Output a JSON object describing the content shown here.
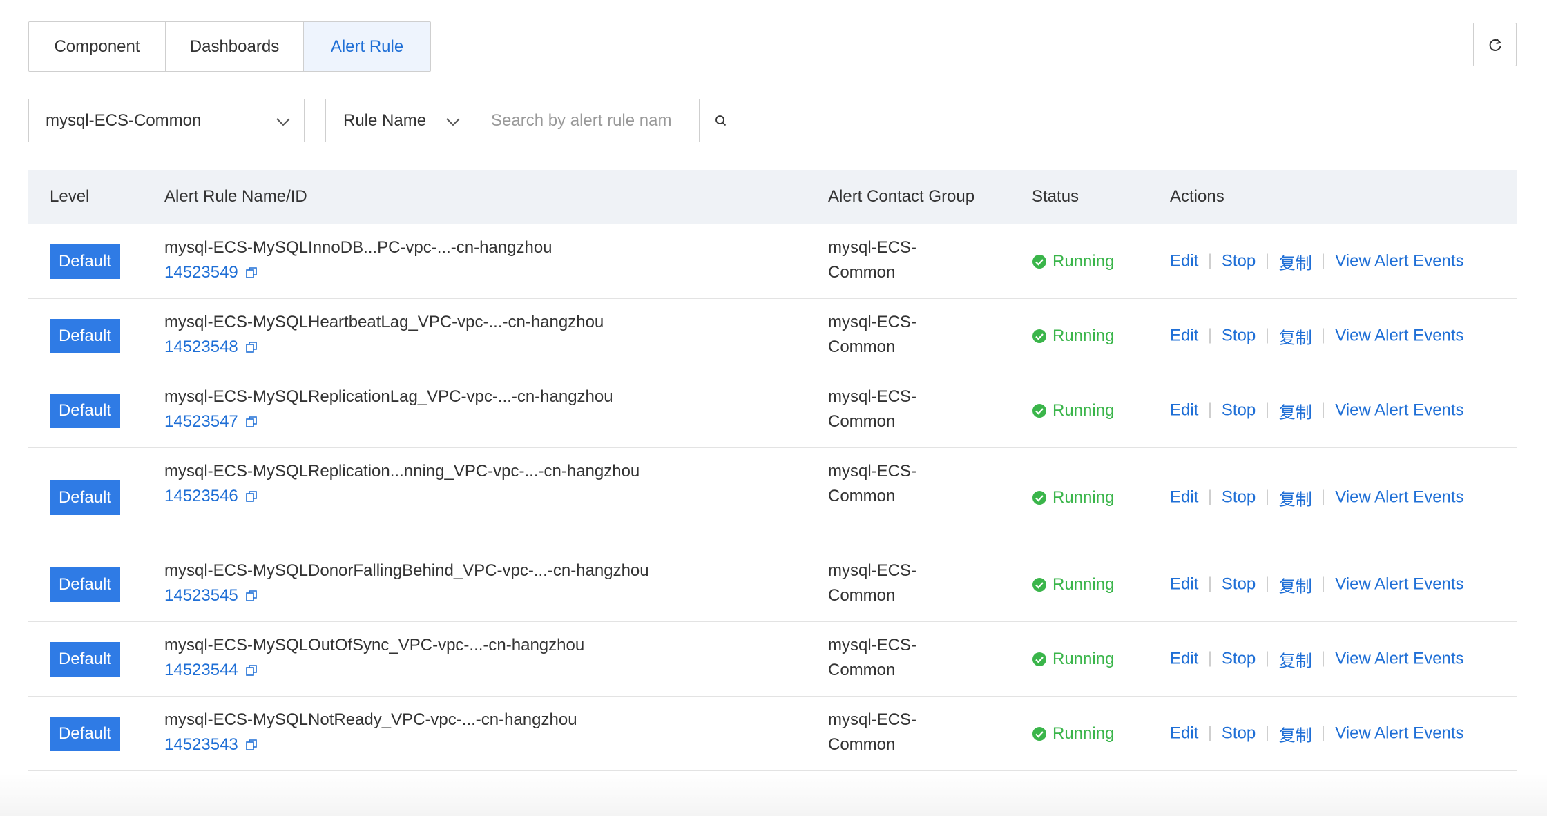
{
  "tabs": [
    {
      "label": "Component",
      "active": false
    },
    {
      "label": "Dashboards",
      "active": false
    },
    {
      "label": "Alert Rule",
      "active": true
    }
  ],
  "filters": {
    "app_select_value": "mysql-ECS-Common",
    "field_select_value": "Rule Name",
    "search_placeholder": "Search by alert rule nam"
  },
  "table": {
    "headers": {
      "level": "Level",
      "name": "Alert Rule Name/ID",
      "group": "Alert Contact Group",
      "status": "Status",
      "actions": "Actions"
    },
    "rows": [
      {
        "level": "Default",
        "name": "mysql-ECS-MySQLInnoDB...PC-vpc-...-cn-hangzhou",
        "id": "14523549",
        "group": "mysql-ECS-Common",
        "status": "Running"
      },
      {
        "level": "Default",
        "name": "mysql-ECS-MySQLHeartbeatLag_VPC-vpc-...-cn-hangzhou",
        "id": "14523548",
        "group": "mysql-ECS-Common",
        "status": "Running"
      },
      {
        "level": "Default",
        "name": "mysql-ECS-MySQLReplicationLag_VPC-vpc-...-cn-hangzhou",
        "id": "14523547",
        "group": "mysql-ECS-Common",
        "status": "Running"
      },
      {
        "level": "Default",
        "name": "mysql-ECS-MySQLReplication...nning_VPC-vpc-...-cn-hangzhou",
        "id": "14523546",
        "group": "mysql-ECS-Common",
        "status": "Running"
      },
      {
        "level": "Default",
        "name": "mysql-ECS-MySQLDonorFallingBehind_VPC-vpc-...-cn-hangzhou",
        "id": "14523545",
        "group": "mysql-ECS-Common",
        "status": "Running"
      },
      {
        "level": "Default",
        "name": "mysql-ECS-MySQLOutOfSync_VPC-vpc-...-cn-hangzhou",
        "id": "14523544",
        "group": "mysql-ECS-Common",
        "status": "Running"
      },
      {
        "level": "Default",
        "name": "mysql-ECS-MySQLNotReady_VPC-vpc-...-cn-hangzhou",
        "id": "14523543",
        "group": "mysql-ECS-Common",
        "status": "Running"
      }
    ],
    "actions": [
      "Edit",
      "Stop",
      "复制",
      "View Alert Events"
    ]
  },
  "colors": {
    "primary": "#1f6fd6",
    "badge": "#2f7be5",
    "running": "#3ab54a",
    "header_bg": "#eff2f6"
  },
  "icons": {
    "refresh": "refresh-icon",
    "search": "search-icon",
    "dropdown": "chevron-down-icon",
    "copy": "copy-icon",
    "status": "check-circle-icon"
  }
}
